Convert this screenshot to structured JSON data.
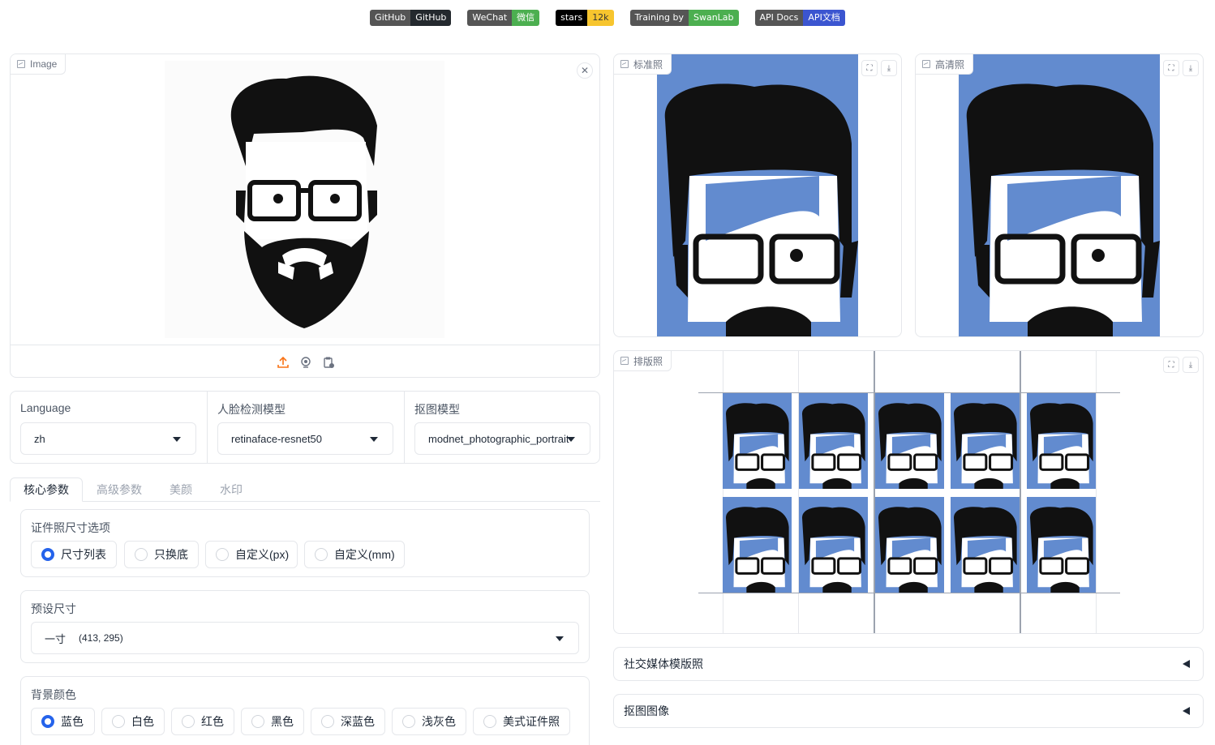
{
  "badges": [
    {
      "left": "GitHub",
      "right": "GitHub",
      "color": "#24292e"
    },
    {
      "left": "WeChat",
      "right": "微信",
      "color": "#4caf50"
    },
    {
      "left": "stars",
      "right": "12k",
      "color": "#f7c52e",
      "left_color": "#000000",
      "right_text_color": "#333333"
    },
    {
      "left": "Training by",
      "right": "SwanLab",
      "color": "#4caf50"
    },
    {
      "left": "API Docs",
      "right": "API文档",
      "color": "#3b55d0"
    }
  ],
  "input_panel": {
    "label": "Image",
    "close_icon": "close-icon",
    "toolbar_icons": [
      "upload-icon",
      "webcam-icon",
      "clipboard-icon"
    ],
    "upload_color": "#f97316"
  },
  "dropdowns": [
    {
      "label": "Language",
      "value": "zh"
    },
    {
      "label": "人脸检测模型",
      "value": "retinaface-resnet50"
    },
    {
      "label": "抠图模型",
      "value": "modnet_photographic_portrait"
    }
  ],
  "tabs": [
    "核心参数",
    "高级参数",
    "美颜",
    "水印"
  ],
  "size_option": {
    "title": "证件照尺寸选项",
    "options": [
      "尺寸列表",
      "只换底",
      "自定义(px)",
      "自定义(mm)"
    ],
    "selected": 0
  },
  "preset_size": {
    "title": "预设尺寸",
    "value_name": "一寸",
    "value_dims": "(413, 295)"
  },
  "bg_color": {
    "title": "背景颜色",
    "options": [
      "蓝色",
      "白色",
      "红色",
      "黑色",
      "深蓝色",
      "浅灰色",
      "美式证件照"
    ],
    "selected": 0
  },
  "outputs": {
    "standard": "标准照",
    "hd": "高清照",
    "layout": "排版照"
  },
  "accordions": [
    "社交媒体模版照",
    "抠图图像"
  ],
  "colors": {
    "accent": "#2563eb",
    "photo_bg": "#628bcf"
  }
}
